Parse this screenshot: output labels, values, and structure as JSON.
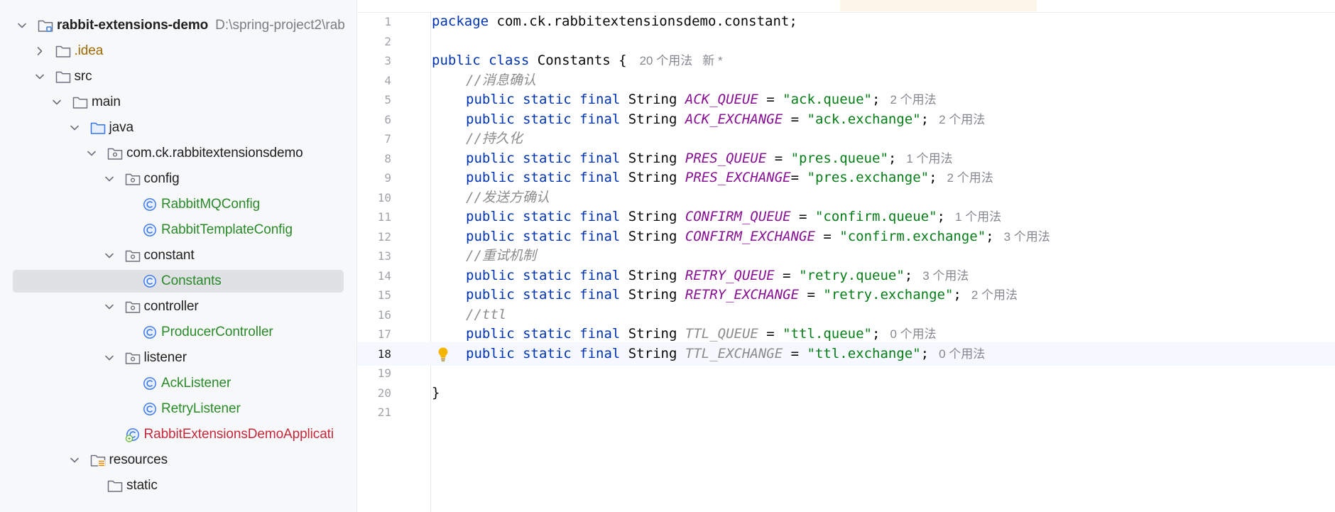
{
  "tree": {
    "items": [
      {
        "label": "rabbit-extensions-demo",
        "path": "D:\\spring-project2\\rab",
        "icon": "module-folder-icon",
        "expanded": true
      },
      {
        "label": ".idea",
        "icon": "folder-icon",
        "expanded": false
      },
      {
        "label": "src",
        "icon": "folder-icon",
        "expanded": true
      },
      {
        "label": "main",
        "icon": "folder-icon",
        "expanded": true
      },
      {
        "label": "java",
        "icon": "source-folder-icon",
        "expanded": true
      },
      {
        "label": "com.ck.rabbitextensionsdemo",
        "icon": "package-icon",
        "expanded": true
      },
      {
        "label": "config",
        "icon": "package-icon",
        "expanded": true
      },
      {
        "label": "RabbitMQConfig",
        "icon": "class-icon"
      },
      {
        "label": "RabbitTemplateConfig",
        "icon": "class-icon"
      },
      {
        "label": "constant",
        "icon": "package-icon",
        "expanded": true
      },
      {
        "label": "Constants",
        "icon": "class-icon",
        "selected": true
      },
      {
        "label": "controller",
        "icon": "package-icon",
        "expanded": true
      },
      {
        "label": "ProducerController",
        "icon": "class-icon"
      },
      {
        "label": "listener",
        "icon": "package-icon",
        "expanded": true
      },
      {
        "label": "AckListener",
        "icon": "class-icon"
      },
      {
        "label": "RetryListener",
        "icon": "class-icon"
      },
      {
        "label": "RabbitExtensionsDemoApplicati",
        "icon": "spring-boot-app-icon"
      },
      {
        "label": "resources",
        "icon": "resources-folder-icon",
        "expanded": true
      },
      {
        "label": "static",
        "icon": "folder-icon"
      }
    ]
  },
  "editor": {
    "current_line": 18,
    "code": {
      "package_kw": "package",
      "package_name": "com.ck.rabbitextensionsdemo.constant;",
      "public_kw": "public",
      "class_kw": "class",
      "class_name": "Constants {",
      "class_usages": "20 个用法",
      "class_new": "新 *",
      "modifiers": "public static final",
      "type": "String",
      "closing_brace": "}",
      "comments": {
        "c4": "//消息确认",
        "c7": "//持久化",
        "c10": "//发送方确认",
        "c13": "//重试机制",
        "c16": "//ttl"
      },
      "fields": {
        "l5": {
          "name": "ACK_QUEUE",
          "op": " = ",
          "value": "\"ack.queue\"",
          "usages": "2 个用法"
        },
        "l6": {
          "name": "ACK_EXCHANGE",
          "op": " = ",
          "value": "\"ack.exchange\"",
          "usages": "2 个用法"
        },
        "l8": {
          "name": "PRES_QUEUE",
          "op": " = ",
          "value": "\"pres.queue\"",
          "usages": "1 个用法"
        },
        "l9": {
          "name": "PRES_EXCHANGE",
          "op": "= ",
          "value": "\"pres.exchange\"",
          "usages": "2 个用法"
        },
        "l11": {
          "name": "CONFIRM_QUEUE",
          "op": " = ",
          "value": "\"confirm.queue\"",
          "usages": "1 个用法"
        },
        "l12": {
          "name": "CONFIRM_EXCHANGE",
          "op": " = ",
          "value": "\"confirm.exchange\"",
          "usages": "3 个用法"
        },
        "l14": {
          "name": "RETRY_QUEUE",
          "op": " = ",
          "value": "\"retry.queue\"",
          "usages": "3 个用法"
        },
        "l15": {
          "name": "RETRY_EXCHANGE",
          "op": " = ",
          "value": "\"retry.exchange\"",
          "usages": "2 个用法"
        },
        "l17": {
          "name": "TTL_QUEUE",
          "op": " = ",
          "value": "\"ttl.queue\"",
          "usages": "0 个用法"
        },
        "l18": {
          "name": "TTL_EXCHANGE",
          "op": " = ",
          "value": "\"ttl.exchange\"",
          "usages": "0 个用法"
        }
      }
    }
  },
  "colors": {
    "keyword": "#0033b3",
    "constant": "#871094",
    "string": "#067d17",
    "comment": "#8c8c8c",
    "class_file": "#2a8a2a",
    "app_file": "#c4283a",
    "selection": "#dfe1e5"
  }
}
